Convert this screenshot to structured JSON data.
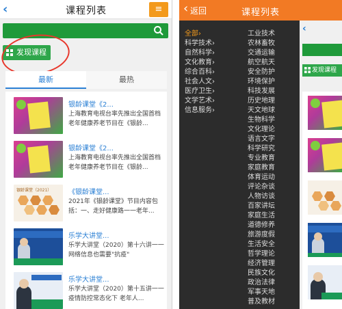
{
  "left": {
    "header": {
      "title": "课程列表",
      "menu_icon": "≡"
    },
    "discover_label": "发现课程",
    "tabs": [
      {
        "label": "最新"
      },
      {
        "label": "最热"
      }
    ],
    "items": [
      {
        "title": "银龄课堂《2...",
        "desc": "上海教育电视台率先推出全国首档老年健康养老节目在《银龄..."
      },
      {
        "title": "银龄课堂《2...",
        "desc": "上海教育电视台率先推出全国首档老年健康养老节目在《银龄..."
      },
      {
        "title": "《银龄课堂...",
        "desc": "2021年《银龄课堂》节目内容包括：一、走好健康路一一老年...",
        "thumb_label": "银龄课堂（2021）"
      },
      {
        "title": "乐学大讲堂...",
        "desc": "乐学大讲堂（2020）第十六讲一一网络信息也需要\"抗疫\""
      },
      {
        "title": "乐学大讲堂...",
        "desc": "乐学大讲堂（2020）第十五讲一一疫情防控常态化下 老年人..."
      }
    ]
  },
  "right": {
    "header": {
      "back_label": "返回",
      "title": "课程列表"
    },
    "categories": [
      {
        "label": "全部",
        "selected": true
      },
      {
        "label": "科学技术"
      },
      {
        "label": "自然科学"
      },
      {
        "label": "文化教育"
      },
      {
        "label": "综合百科"
      },
      {
        "label": "社会人文"
      },
      {
        "label": "医疗卫生"
      },
      {
        "label": "文学艺术"
      },
      {
        "label": "信息服务"
      }
    ],
    "subcategories": [
      "工业技术",
      "农林畜牧",
      "交通运输",
      "航空航天",
      "安全防护",
      "环境保护",
      "科技发展",
      "历史地理",
      "天文地球",
      "生物科学",
      "文化理论",
      "语言文字",
      "科学研究",
      "专业教育",
      "家庭教育",
      "体育运动",
      "评论杂谈",
      "人物访谈",
      "百家讲坛",
      "家庭生活",
      "道德修养",
      "旅游度假",
      "生活安全",
      "哲学理论",
      "经济管理",
      "民族文化",
      "政治法律",
      "军事天地",
      "普及教材"
    ],
    "peek_discover_label": "发现课程"
  },
  "colors": {
    "orange": "#f27a24",
    "green": "#1f9a3a",
    "blue_link": "#2a7fd4",
    "annotation_red": "#e8372c"
  }
}
